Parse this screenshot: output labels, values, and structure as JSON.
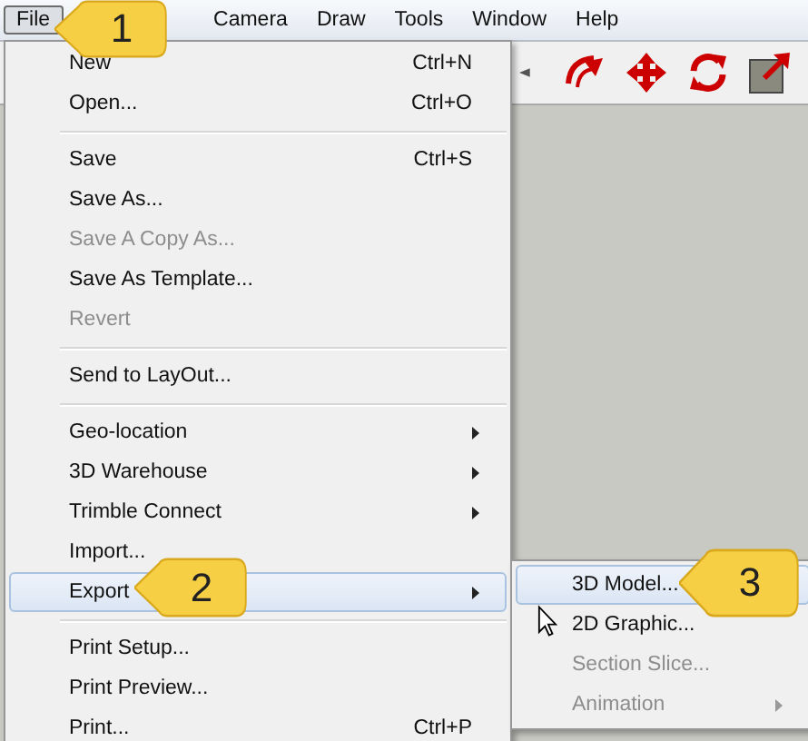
{
  "menubar": [
    {
      "label": "File",
      "selected": true
    },
    {
      "label": "Camera",
      "selected": false
    },
    {
      "label": "Draw",
      "selected": false
    },
    {
      "label": "Tools",
      "selected": false
    },
    {
      "label": "Window",
      "selected": false
    },
    {
      "label": "Help",
      "selected": false
    }
  ],
  "file_menu": [
    {
      "kind": "item",
      "label": "New",
      "shortcut": "Ctrl+N",
      "disabled": false,
      "submenu": false,
      "selected": false
    },
    {
      "kind": "item",
      "label": "Open...",
      "shortcut": "Ctrl+O",
      "disabled": false,
      "submenu": false,
      "selected": false
    },
    {
      "kind": "separator"
    },
    {
      "kind": "item",
      "label": "Save",
      "shortcut": "Ctrl+S",
      "disabled": false,
      "submenu": false,
      "selected": false
    },
    {
      "kind": "item",
      "label": "Save As...",
      "disabled": false,
      "submenu": false,
      "selected": false
    },
    {
      "kind": "item",
      "label": "Save A Copy As...",
      "disabled": true,
      "submenu": false,
      "selected": false
    },
    {
      "kind": "item",
      "label": "Save As Template...",
      "disabled": false,
      "submenu": false,
      "selected": false
    },
    {
      "kind": "item",
      "label": "Revert",
      "disabled": true,
      "submenu": false,
      "selected": false
    },
    {
      "kind": "separator"
    },
    {
      "kind": "item",
      "label": "Send to LayOut...",
      "disabled": false,
      "submenu": false,
      "selected": false
    },
    {
      "kind": "separator"
    },
    {
      "kind": "item",
      "label": "Geo-location",
      "disabled": false,
      "submenu": true,
      "selected": false
    },
    {
      "kind": "item",
      "label": "3D Warehouse",
      "disabled": false,
      "submenu": true,
      "selected": false
    },
    {
      "kind": "item",
      "label": "Trimble Connect",
      "disabled": false,
      "submenu": true,
      "selected": false
    },
    {
      "kind": "item",
      "label": "Import...",
      "disabled": false,
      "submenu": false,
      "selected": false
    },
    {
      "kind": "item",
      "label": "Export",
      "disabled": false,
      "submenu": true,
      "selected": true
    },
    {
      "kind": "separator"
    },
    {
      "kind": "item",
      "label": "Print Setup...",
      "disabled": false,
      "submenu": false,
      "selected": false
    },
    {
      "kind": "item",
      "label": "Print Preview...",
      "disabled": false,
      "submenu": false,
      "selected": false
    },
    {
      "kind": "item",
      "label": "Print...",
      "shortcut": "Ctrl+P",
      "disabled": false,
      "submenu": false,
      "selected": false
    }
  ],
  "export_submenu": [
    {
      "label": "3D Model...",
      "disabled": false,
      "submenu": false,
      "selected": true
    },
    {
      "label": "2D Graphic...",
      "disabled": false,
      "submenu": false,
      "selected": false
    },
    {
      "label": "Section Slice...",
      "disabled": true,
      "submenu": false,
      "selected": false
    },
    {
      "label": "Animation",
      "disabled": true,
      "submenu": true,
      "selected": false
    }
  ],
  "callouts": [
    "1",
    "2",
    "3"
  ]
}
